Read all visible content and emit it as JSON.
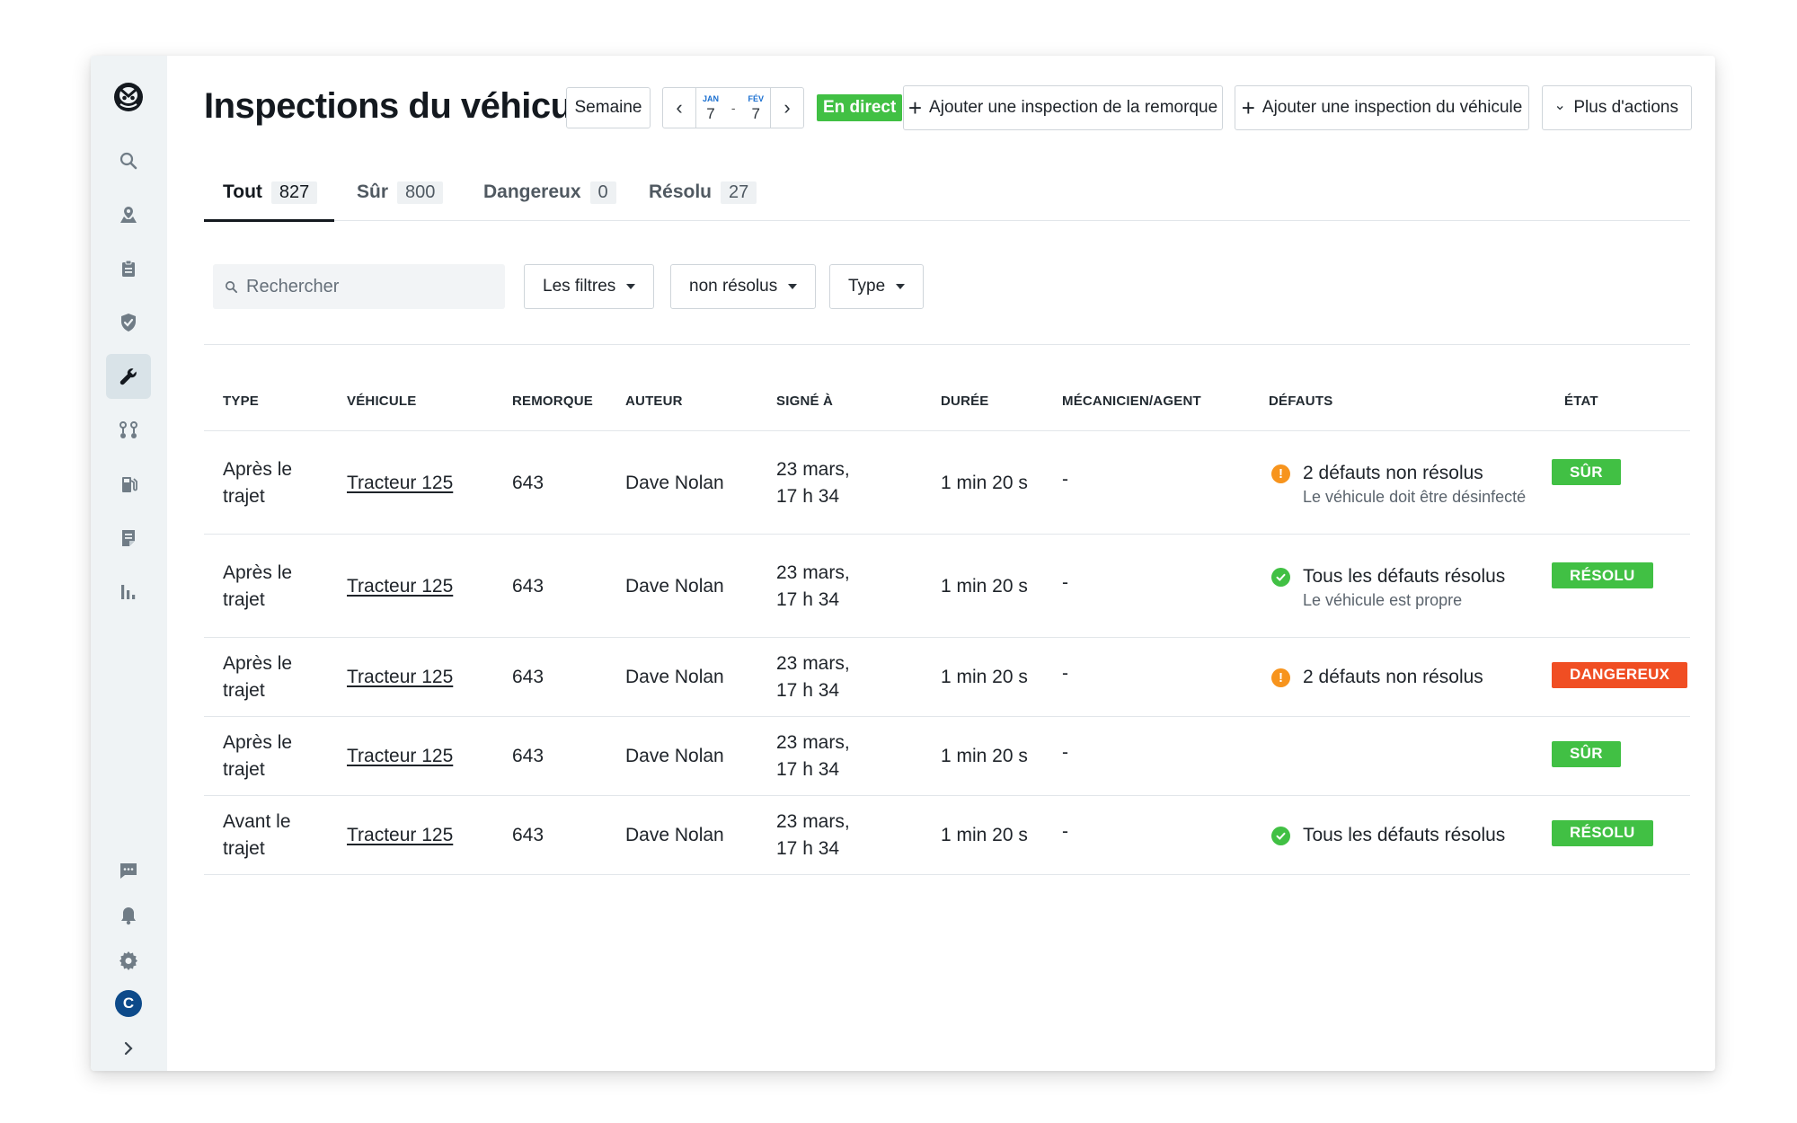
{
  "colors": {
    "safe": "#41c044",
    "resolved": "#41c044",
    "danger": "#f04e23",
    "warning": "#f7941d",
    "live": "#41c044",
    "accent": "#1a6fd0"
  },
  "header": {
    "title": "Inspections du véhicule",
    "period_label": "Semaine",
    "date_range": {
      "start_month": "JAN",
      "start_day": "7",
      "separator": "-",
      "end_month": "FÉV",
      "end_day": "7"
    },
    "live_label": "En direct",
    "add_trailer_label": "Ajouter une inspection de la remorque",
    "add_vehicle_label": "Ajouter une inspection du véhicule",
    "more_actions_label": "Plus d'actions"
  },
  "tabs": [
    {
      "label": "Tout",
      "count": "827"
    },
    {
      "label": "Sûr",
      "count": "800"
    },
    {
      "label": "Dangereux",
      "count": "0"
    },
    {
      "label": "Résolu",
      "count": "27"
    }
  ],
  "search": {
    "placeholder": "Rechercher",
    "value": ""
  },
  "filters": {
    "filters_label": "Les filtres",
    "status_label": "non résolus",
    "type_label": "Type"
  },
  "table": {
    "columns": [
      "TYPE",
      "VÉHICULE",
      "REMORQUE",
      "AUTEUR",
      "SIGNÉ À",
      "DURÉE",
      "MÉCANICIEN/AGENT",
      "DÉFAUTS",
      "ÉTAT"
    ],
    "rows": [
      {
        "type_line1": "Après le",
        "type_line2": "trajet",
        "vehicle": "Tracteur 125",
        "trailer": "643",
        "author": "Dave Nolan",
        "signed_line1": "23 mars,",
        "signed_line2": "17 h 34",
        "duration": "1 min 20 s",
        "mechanic": "-",
        "defect_icon": "warning-icon",
        "defect_text": "2 défauts non résolus",
        "defect_sub": "Le véhicule doit être désinfecté",
        "status": "SÛR"
      },
      {
        "type_line1": "Après le",
        "type_line2": "trajet",
        "vehicle": "Tracteur 125",
        "trailer": "643",
        "author": "Dave Nolan",
        "signed_line1": "23 mars,",
        "signed_line2": "17 h 34",
        "duration": "1 min 20 s",
        "mechanic": "-",
        "defect_icon": "check-circle-icon",
        "defect_text": "Tous les défauts résolus",
        "defect_sub": "Le véhicule est propre",
        "status": "RÉSOLU"
      },
      {
        "type_line1": "Après le",
        "type_line2": "trajet",
        "vehicle": "Tracteur 125",
        "trailer": "643",
        "author": "Dave Nolan",
        "signed_line1": "23 mars,",
        "signed_line2": "17 h 34",
        "duration": "1 min 20 s",
        "mechanic": "-",
        "defect_icon": "warning-icon",
        "defect_text": "2 défauts non résolus",
        "defect_sub": "",
        "status": "DANGEREUX"
      },
      {
        "type_line1": "Après le",
        "type_line2": "trajet",
        "vehicle": "Tracteur 125",
        "trailer": "643",
        "author": "Dave Nolan",
        "signed_line1": "23 mars,",
        "signed_line2": "17 h 34",
        "duration": "1 min 20 s",
        "mechanic": "-",
        "defect_icon": "",
        "defect_text": "",
        "defect_sub": "",
        "status": "SÛR"
      },
      {
        "type_line1": "Avant le",
        "type_line2": "trajet",
        "vehicle": "Tracteur 125",
        "trailer": "643",
        "author": "Dave Nolan",
        "signed_line1": "23 mars,",
        "signed_line2": "17 h 34",
        "duration": "1 min 20 s",
        "mechanic": "-",
        "defect_icon": "check-circle-icon",
        "defect_text": "Tous les défauts résolus",
        "defect_sub": "",
        "status": "RÉSOLU"
      }
    ]
  },
  "sidebar": {
    "top_items": [
      "search-icon",
      "map-pin-icon",
      "clipboard-icon",
      "shield-check-icon",
      "wrench-icon",
      "route-icon",
      "fuel-icon",
      "document-icon",
      "bar-chart-icon"
    ],
    "active_item": "wrench-icon",
    "bottom_items": [
      "chat-icon",
      "bell-icon",
      "gear-icon"
    ],
    "avatar_initial": "C",
    "expand_icon": "chevron-right-icon"
  }
}
